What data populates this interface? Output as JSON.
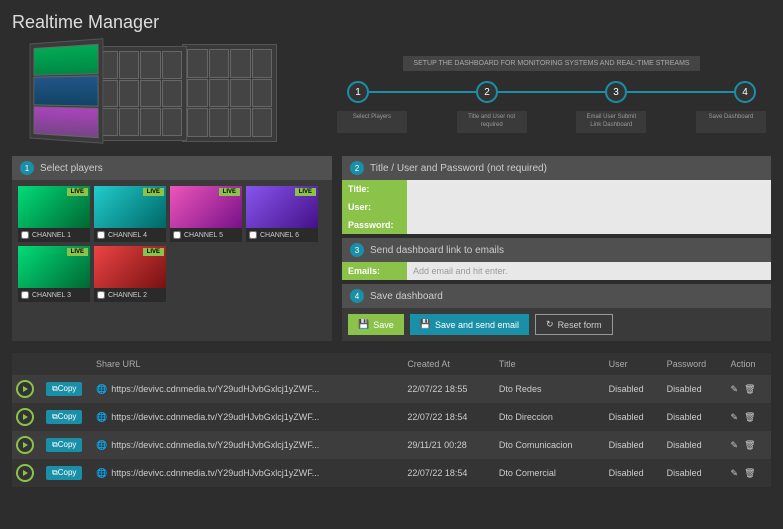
{
  "page_title": "Realtime Manager",
  "setup_label": "SETUP THE DASHBOARD FOR MONITORING SYSTEMS AND REAL-TIME STREAMS",
  "steps": [
    {
      "num": "1",
      "caption": "Select Players"
    },
    {
      "num": "2",
      "caption": "Title and User not required"
    },
    {
      "num": "3",
      "caption": "Email User Submit Link Dashboard"
    },
    {
      "num": "4",
      "caption": "Save Dashboard"
    }
  ],
  "panel1": {
    "num": "1",
    "title": "Select players"
  },
  "panel2": {
    "num": "2",
    "title": "Title / User and Password (not required)"
  },
  "panel3": {
    "num": "3",
    "title": "Send dashboard link to emails"
  },
  "panel4": {
    "num": "4",
    "title": "Save dashboard"
  },
  "players": [
    {
      "name": "CHANNEL 1",
      "live": "LIVE",
      "bg": "bg-green"
    },
    {
      "name": "CHANNEL 4",
      "live": "LIVE",
      "bg": "bg-teal"
    },
    {
      "name": "CHANNEL 5",
      "live": "LIVE",
      "bg": "bg-pink"
    },
    {
      "name": "CHANNEL 6",
      "live": "LIVE",
      "bg": "bg-purple"
    },
    {
      "name": "CHANNEL 3",
      "live": "LIVE",
      "bg": "bg-green"
    },
    {
      "name": "CHANNEL 2",
      "live": "LIVE",
      "bg": "bg-red"
    }
  ],
  "form": {
    "title_label": "Title:",
    "user_label": "User:",
    "password_label": "Password:",
    "emails_label": "Emails:",
    "emails_placeholder": "Add email and hit enter."
  },
  "buttons": {
    "save": "Save",
    "save_send": "Save and send email",
    "reset": "Reset form",
    "copy": "Copy"
  },
  "table": {
    "headers": {
      "share": "Share URL",
      "created": "Created At",
      "title": "Title",
      "user": "User",
      "password": "Password",
      "action": "Action"
    },
    "disabled": "Disabled",
    "rows": [
      {
        "url": "https://devivc.cdnmedia.tv/Y29udHJvbGxlcj1yZWF...",
        "created": "22/07/22 18:55",
        "title": "Dto Redes"
      },
      {
        "url": "https://devivc.cdnmedia.tv/Y29udHJvbGxlcj1yZWF...",
        "created": "22/07/22 18:54",
        "title": "Dto Direccion"
      },
      {
        "url": "https://devivc.cdnmedia.tv/Y29udHJvbGxlcj1yZWF...",
        "created": "29/11/21 00:28",
        "title": "Dto Comunicacion"
      },
      {
        "url": "https://devivc.cdnmedia.tv/Y29udHJvbGxlcj1yZWF...",
        "created": "22/07/22 18:54",
        "title": "Dto Comercial"
      }
    ]
  }
}
